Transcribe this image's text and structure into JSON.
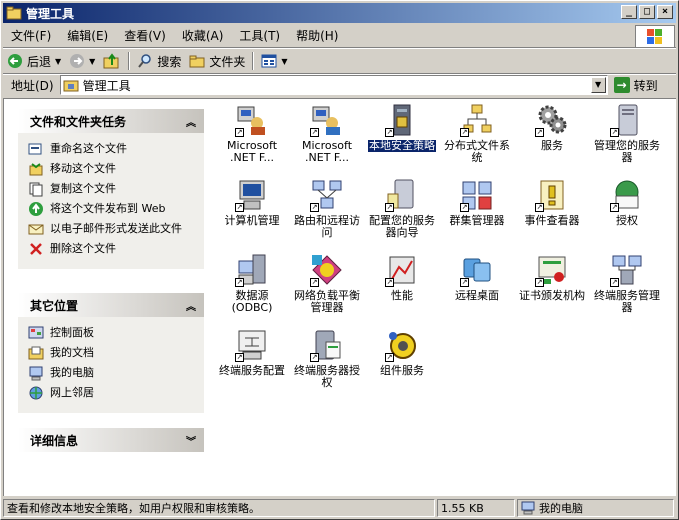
{
  "window": {
    "title": "管理工具",
    "controls": [
      "_",
      "□",
      "×"
    ]
  },
  "menu": [
    "文件(F)",
    "编辑(E)",
    "查看(V)",
    "收藏(A)",
    "工具(T)",
    "帮助(H)"
  ],
  "toolbar": {
    "back": "后退",
    "search": "搜索",
    "folders": "文件夹"
  },
  "address": {
    "label": "地址(D)",
    "value": "管理工具",
    "go": "转到"
  },
  "panels": {
    "tasks": {
      "title": "文件和文件夹任务",
      "items": [
        "重命名这个文件",
        "移动这个文件",
        "复制这个文件",
        "将这个文件发布到 Web",
        "以电子邮件形式发送此文件",
        "删除这个文件"
      ]
    },
    "other": {
      "title": "其它位置",
      "items": [
        "控制面板",
        "我的文档",
        "我的电脑",
        "网上邻居"
      ]
    },
    "details": {
      "title": "详细信息"
    }
  },
  "icons": [
    [
      "Microsoft .NET F...",
      "Microsoft .NET F...",
      "本地安全策略",
      "分布式文件系统",
      "服务",
      "管理您的服务器"
    ],
    [
      "计算机管理",
      "路由和远程访问",
      "配置您的服务器向导",
      "群集管理器",
      "事件查看器",
      "授权"
    ],
    [
      "数据源 (ODBC)",
      "网络负载平衡管理器",
      "性能",
      "远程桌面",
      "证书颁发机构",
      "终端服务管理器"
    ],
    [
      "终端服务配置",
      "终端服务器授权",
      "组件服务"
    ]
  ],
  "selected_icon": "本地安全策略",
  "status": {
    "description": "查看和修改本地安全策略，如用户权限和审核策略。",
    "size": "1.55 KB",
    "location": "我的电脑"
  }
}
